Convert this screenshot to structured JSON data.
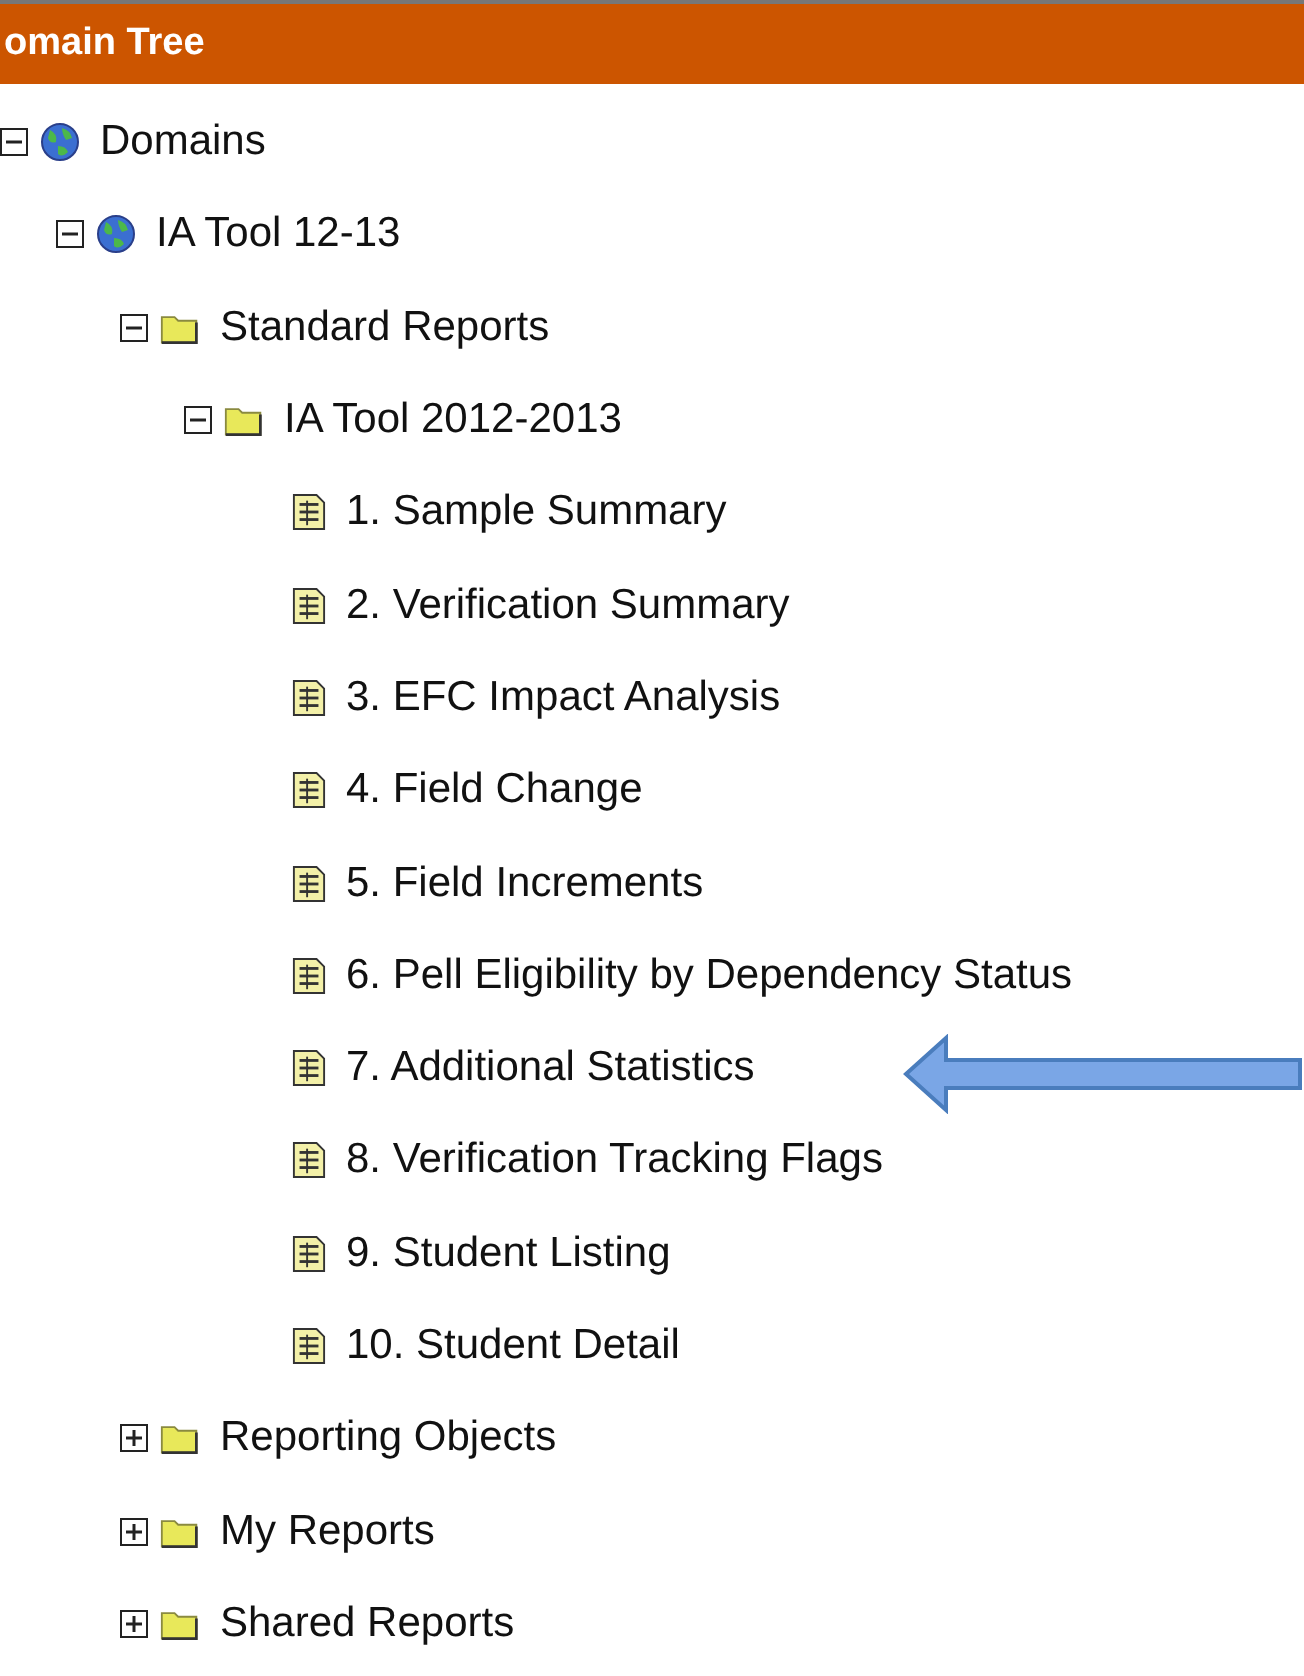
{
  "header": {
    "title": "omain Tree"
  },
  "tree": [
    {
      "label": "Domains",
      "kind": "domain",
      "expanded": true,
      "children": [
        {
          "label": "IA Tool 12-13",
          "kind": "domain",
          "expanded": true,
          "children": [
            {
              "label": "Standard Reports",
              "kind": "folder",
              "expanded": true,
              "children": [
                {
                  "label": "IA Tool 2012-2013",
                  "kind": "folder",
                  "expanded": true,
                  "children": [
                    {
                      "label": "1. Sample Summary",
                      "kind": "report"
                    },
                    {
                      "label": "2. Verification Summary",
                      "kind": "report"
                    },
                    {
                      "label": "3. EFC Impact Analysis",
                      "kind": "report"
                    },
                    {
                      "label": "4. Field Change",
                      "kind": "report"
                    },
                    {
                      "label": "5. Field Increments",
                      "kind": "report"
                    },
                    {
                      "label": "6. Pell Eligibility by Dependency Status",
                      "kind": "report"
                    },
                    {
                      "label": "7. Additional Statistics",
                      "kind": "report"
                    },
                    {
                      "label": "8. Verification Tracking Flags",
                      "kind": "report"
                    },
                    {
                      "label": "9. Student Listing",
                      "kind": "report"
                    },
                    {
                      "label": "10. Student Detail",
                      "kind": "report"
                    }
                  ]
                }
              ]
            },
            {
              "label": "Reporting Objects",
              "kind": "folder",
              "expanded": false
            },
            {
              "label": "My Reports",
              "kind": "folder",
              "expanded": false
            },
            {
              "label": "Shared Reports",
              "kind": "folder",
              "expanded": false
            }
          ]
        }
      ]
    }
  ]
}
